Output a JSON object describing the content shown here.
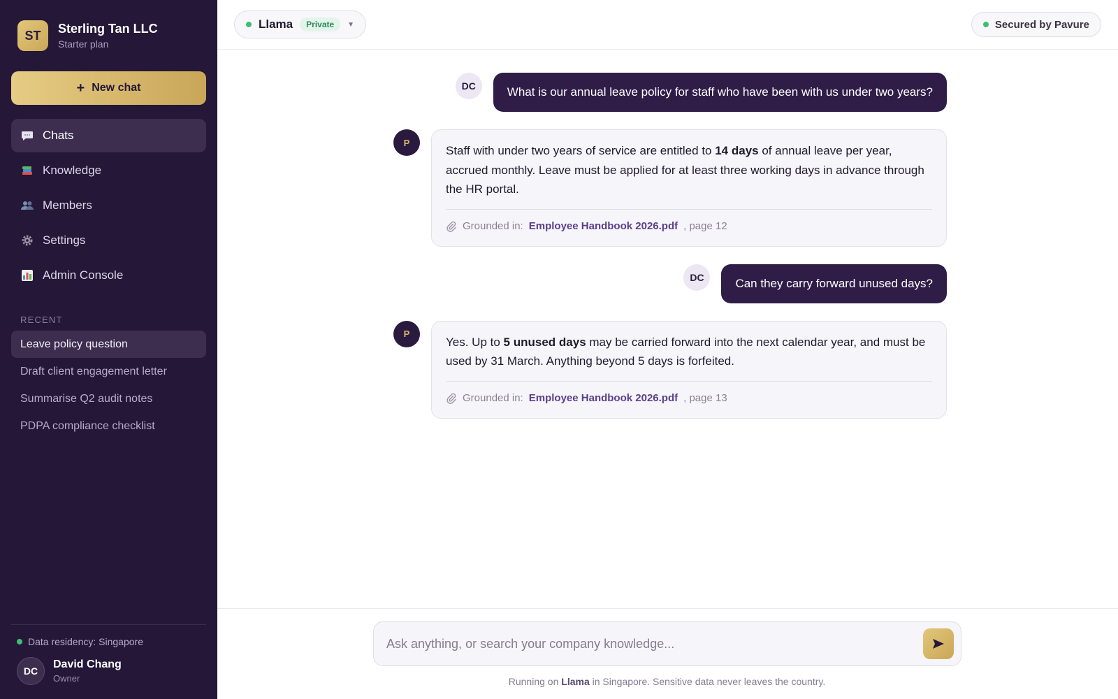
{
  "org": {
    "initials": "ST",
    "name": "Sterling Tan LLC",
    "plan": "Starter plan"
  },
  "new_chat_label": "New chat",
  "nav": [
    {
      "label": "Chats",
      "icon": "speech-bubble-icon"
    },
    {
      "label": "Knowledge",
      "icon": "books-icon"
    },
    {
      "label": "Members",
      "icon": "people-icon"
    },
    {
      "label": "Settings",
      "icon": "gear-icon"
    },
    {
      "label": "Admin Console",
      "icon": "bar-chart-icon"
    }
  ],
  "recent": {
    "title": "RECENT",
    "items": [
      "Leave policy question",
      "Draft client engagement letter",
      "Summarise Q2 audit notes",
      "PDPA compliance checklist"
    ]
  },
  "residency": "Data residency: Singapore",
  "user": {
    "initials": "DC",
    "name": "David Chang",
    "role": "Owner"
  },
  "topbar": {
    "model": "Llama",
    "badge": "Private",
    "secured": "Secured by Pavure"
  },
  "messages": [
    {
      "role": "user",
      "avatar": "DC",
      "text": "What is our annual leave policy for staff who have been with us under two years?"
    },
    {
      "role": "assistant",
      "avatar": "P",
      "parts": [
        "Staff with under two years of service are entitled to ",
        "14 days",
        " of annual leave per year, accrued monthly. Leave must be applied for at least three working days in advance through the HR portal."
      ],
      "grounded_label": "Grounded in:",
      "source": "Employee Handbook 2026.pdf",
      "page": ", page 12"
    },
    {
      "role": "user",
      "avatar": "DC",
      "text": "Can they carry forward unused days?"
    },
    {
      "role": "assistant",
      "avatar": "P",
      "parts": [
        "Yes. Up to ",
        "5 unused days",
        " may be carried forward into the next calendar year, and must be used by 31 March. Anything beyond 5 days is forfeited."
      ],
      "grounded_label": "Grounded in:",
      "source": "Employee Handbook 2026.pdf",
      "page": ", page 13"
    }
  ],
  "composer": {
    "placeholder": "Ask anything, or search your company knowledge...",
    "value": ""
  },
  "footnote": {
    "pre": "Running on ",
    "model": "Llama",
    "post": " in Singapore. Sensitive data never leaves the country."
  },
  "colors": {
    "sidebar_bg": "#241737",
    "accent_gold": "#d4b56a",
    "user_bubble": "#2f1d48",
    "status_green": "#3cbf74"
  }
}
